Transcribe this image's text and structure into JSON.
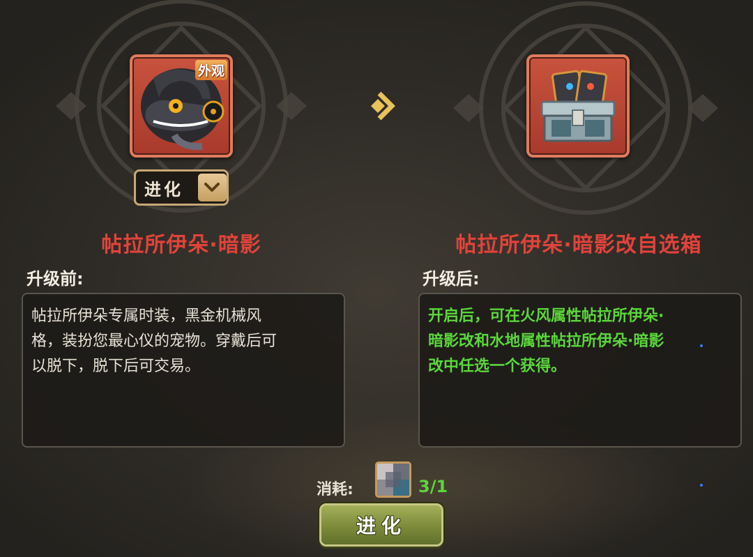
{
  "colors": {
    "name_red": "#e0433a",
    "effect_green": "#5bd63b",
    "card_red": "#c8533e",
    "button_olive": "#7c8a3a"
  },
  "source_item": {
    "tag": "外观",
    "icon": "dark-dinosaur-pet-icon",
    "evolve_select_label": "进化",
    "dropdown_icon": "chevron-down-icon",
    "name": "帖拉所伊朵·暗影"
  },
  "arrow_icon": "chevron-right-icon",
  "target_item": {
    "icon": "treasure-chest-icon",
    "name": "帖拉所伊朵·暗影改自选箱"
  },
  "before": {
    "label": "升级前:",
    "description_lines": [
      "帖拉所伊朵专属时装，黑金机械风",
      "格，装扮您最心仪的宠物。穿戴后可",
      "以脱下，脱下后可交易。"
    ]
  },
  "after": {
    "label": "升级后:",
    "description_lines": [
      "开启后，可在火风属性帖拉所伊朵·",
      "暗影改和水地属性帖拉所伊朵·暗影",
      "改中任选一个获得。"
    ]
  },
  "cost": {
    "label": "消耗:",
    "material_icon": "blurred-material-icon",
    "count": "3/1"
  },
  "evolve_button_label": "进化"
}
